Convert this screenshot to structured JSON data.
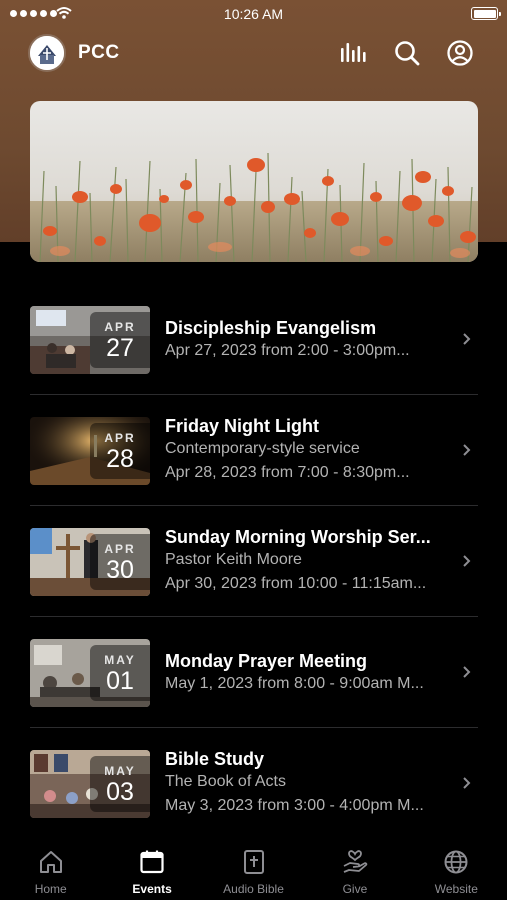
{
  "status_bar": {
    "time": "10:26 AM"
  },
  "header": {
    "title": "PCC",
    "icons": [
      "live-bars-icon",
      "search-icon",
      "account-icon"
    ]
  },
  "hero": {
    "image": "poppy-field-photo"
  },
  "events": [
    {
      "month": "APR",
      "day": "27",
      "title": "Discipleship Evangelism",
      "subtitle": "",
      "detail": "Apr 27, 2023 from 2:00 - 3:00pm..."
    },
    {
      "month": "APR",
      "day": "28",
      "title": "Friday Night Light",
      "subtitle": "Contemporary-style service",
      "detail": "Apr 28, 2023 from 7:00 - 8:30pm..."
    },
    {
      "month": "APR",
      "day": "30",
      "title": "Sunday Morning Worship Ser...",
      "subtitle": "Pastor Keith Moore",
      "detail": "Apr 30, 2023 from 10:00 - 11:15am..."
    },
    {
      "month": "MAY",
      "day": "01",
      "title": "Monday Prayer Meeting",
      "subtitle": "",
      "detail": "May 1, 2023 from 8:00 - 9:00am M..."
    },
    {
      "month": "MAY",
      "day": "03",
      "title": "Bible Study",
      "subtitle": "The Book of Acts",
      "detail": "May 3, 2023 from 3:00 - 4:00pm M..."
    }
  ],
  "tabs": [
    {
      "label": "Home",
      "icon": "home-icon",
      "active": false
    },
    {
      "label": "Events",
      "icon": "calendar-icon",
      "active": true
    },
    {
      "label": "Audio Bible",
      "icon": "bible-icon",
      "active": false
    },
    {
      "label": "Give",
      "icon": "give-hand-icon",
      "active": false
    },
    {
      "label": "Website",
      "icon": "globe-icon",
      "active": false
    }
  ],
  "colors": {
    "header_brown": "#6e4a30",
    "background": "#000000",
    "tab_inactive": "#8e8e93"
  }
}
